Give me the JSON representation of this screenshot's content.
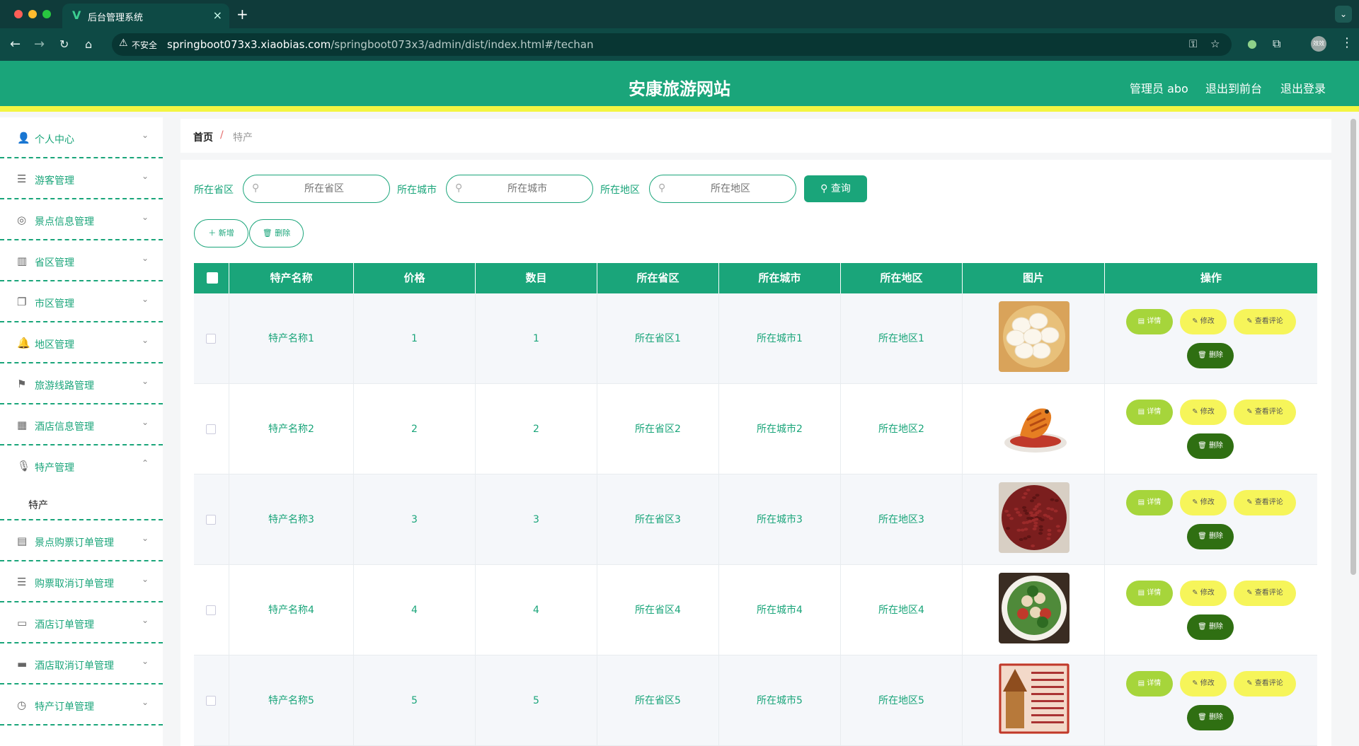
{
  "browser": {
    "tab_title": "后台管理系统",
    "tab_favicon": "V",
    "security_label": "不安全",
    "url_host": "springboot073x3.xiaobias.com",
    "url_path": "/springboot073x3/admin/dist/index.html#/techan",
    "profile_label": "效效"
  },
  "header": {
    "site_title": "安康旅游网站",
    "admin_label": "管理员 abo",
    "front_link": "退出到前台",
    "logout_link": "退出登录",
    "primary_color": "#1aa57a",
    "accent_color": "#f3f542"
  },
  "sidebar": {
    "items": [
      {
        "label": "个人中心",
        "icon": "user-icon"
      },
      {
        "label": "游客管理",
        "icon": "list-icon"
      },
      {
        "label": "景点信息管理",
        "icon": "compass-icon"
      },
      {
        "label": "省区管理",
        "icon": "chart-icon"
      },
      {
        "label": "市区管理",
        "icon": "copy-icon"
      },
      {
        "label": "地区管理",
        "icon": "bell-icon"
      },
      {
        "label": "旅游线路管理",
        "icon": "flag-icon"
      },
      {
        "label": "酒店信息管理",
        "icon": "grid-icon"
      },
      {
        "label": "特产管理",
        "icon": "mic-icon"
      },
      {
        "label": "景点购票订单管理",
        "icon": "clipboard-icon"
      },
      {
        "label": "购票取消订单管理",
        "icon": "list-icon"
      },
      {
        "label": "酒店订单管理",
        "icon": "monitor-icon"
      },
      {
        "label": "酒店取消订单管理",
        "icon": "printer-icon"
      },
      {
        "label": "特产订单管理",
        "icon": "clock-icon"
      }
    ],
    "submenu": {
      "label": "特产"
    }
  },
  "breadcrumb": {
    "home": "首页",
    "separator": "/",
    "current": "特产"
  },
  "search": {
    "province_label": "所在省区",
    "province_placeholder": "所在省区",
    "city_label": "所在城市",
    "city_placeholder": "所在城市",
    "district_label": "所在地区",
    "district_placeholder": "所在地区",
    "button": "查询"
  },
  "toolbar": {
    "add": "新增",
    "delete": "删除"
  },
  "table": {
    "columns": [
      "特产名称",
      "价格",
      "数目",
      "所在省区",
      "所在城市",
      "所在地区",
      "图片",
      "操作"
    ],
    "actions": {
      "detail": "详情",
      "edit": "修改",
      "review": "查看评论",
      "delete": "删除"
    },
    "rows": [
      {
        "name": "特产名称1",
        "price": "1",
        "count": "1",
        "province": "所在省区1",
        "city": "所在城市1",
        "district": "所在地区1",
        "image": "steamed-buns-image"
      },
      {
        "name": "特产名称2",
        "price": "2",
        "count": "2",
        "province": "所在省区2",
        "city": "所在城市2",
        "district": "所在地区2",
        "image": "braised-fish-image"
      },
      {
        "name": "特产名称3",
        "price": "3",
        "count": "3",
        "province": "所在省区3",
        "city": "所在城市3",
        "district": "所在地区3",
        "image": "red-beans-image"
      },
      {
        "name": "特产名称4",
        "price": "4",
        "count": "4",
        "province": "所在省区4",
        "city": "所在城市4",
        "district": "所在地区4",
        "image": "salad-bowl-image"
      },
      {
        "name": "特产名称5",
        "price": "5",
        "count": "5",
        "province": "所在省区5",
        "city": "所在城市5",
        "district": "所在地区5",
        "image": "pagoda-poster-image"
      }
    ]
  }
}
